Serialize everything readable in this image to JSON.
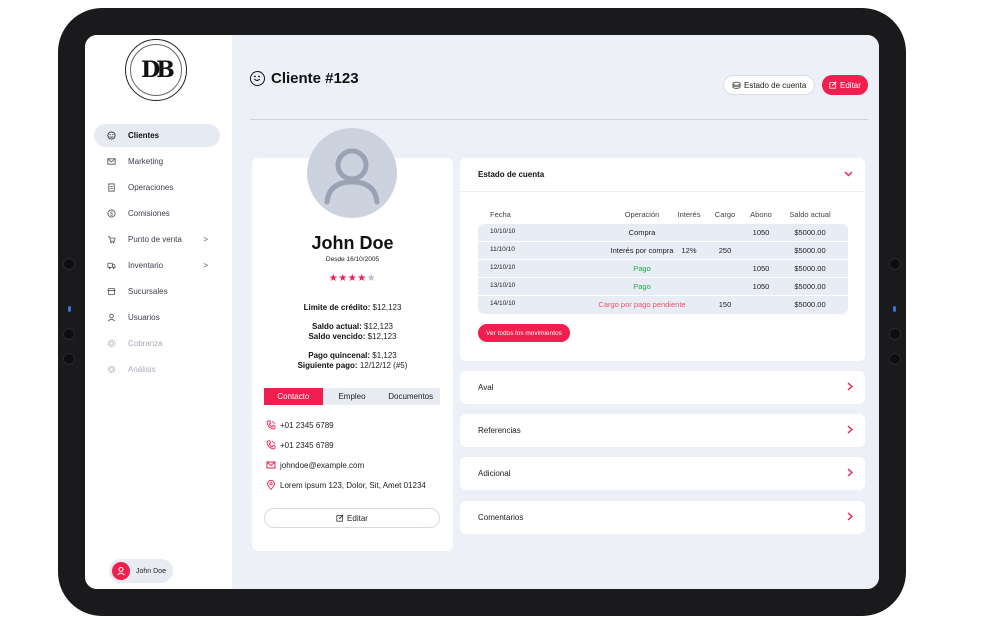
{
  "app": {
    "logo_text": "DB"
  },
  "sidebar": {
    "items": [
      {
        "label": "Clientes",
        "icon": "smile-icon"
      },
      {
        "label": "Marketing",
        "icon": "mail-icon"
      },
      {
        "label": "Operaciones",
        "icon": "document-icon"
      },
      {
        "label": "Comisiones",
        "icon": "coin-icon"
      },
      {
        "label": "Punto de venta",
        "icon": "cart-icon",
        "chevron": ">"
      },
      {
        "label": "Inventario",
        "icon": "truck-icon",
        "chevron": ">"
      },
      {
        "label": "Sucursales",
        "icon": "store-icon"
      },
      {
        "label": "Usuarios",
        "icon": "user-icon"
      },
      {
        "label": "Cobranza",
        "icon": "gear-icon"
      },
      {
        "label": "Análisis",
        "icon": "gear-icon"
      }
    ],
    "user_chip": {
      "name": "John Doe"
    }
  },
  "header": {
    "title": "Cliente #123",
    "account_button": "Estado de cuenta",
    "edit_button": "Editar"
  },
  "profile": {
    "name": "John Doe",
    "since": "Desde 16/10/2005",
    "rating": 4,
    "rating_max": 5,
    "credit_limit_label": "Limite de crédito:",
    "credit_limit_value": "$12,123",
    "saldo_actual_label": "Saldo actual:",
    "saldo_actual_value": "$12,123",
    "saldo_vencido_label": "Saldo vencido:",
    "saldo_vencido_value": "$12,123",
    "pago_label": "Pago quincenal:",
    "pago_value": "$1,123",
    "siguiente_label": "Siguiente pago:",
    "siguiente_value": "12/12/12 (#5)",
    "tabs": [
      "Contacto",
      "Empleo",
      "Documentos"
    ],
    "contacts": [
      {
        "icon": "phone-icon",
        "text": "+01 2345 6789"
      },
      {
        "icon": "phone-icon",
        "text": "+01 2345 6789"
      },
      {
        "icon": "mail-icon",
        "text": "johndoe@example.com"
      },
      {
        "icon": "location-icon",
        "text": "Lorem ipsum 123, Dolor, Sit, Amet 01234"
      }
    ],
    "edit_button": "Editar"
  },
  "account": {
    "title": "Estado de cuenta",
    "columns": [
      "Fecha",
      "Operación",
      "Interés",
      "Cargo",
      "Abono",
      "Saldo actual"
    ],
    "rows": [
      {
        "fecha": "10/10/10",
        "operacion": "Compra",
        "interes": "",
        "cargo": "",
        "abono": "1050",
        "saldo": "$5000.00",
        "type": "normal"
      },
      {
        "fecha": "11/10/10",
        "operacion": "Interés por compra",
        "interes": "12%",
        "cargo": "250",
        "abono": "",
        "saldo": "$5000.00",
        "type": "normal"
      },
      {
        "fecha": "12/10/10",
        "operacion": "Pago",
        "interes": "",
        "cargo": "",
        "abono": "1050",
        "saldo": "$5000.00",
        "type": "pago"
      },
      {
        "fecha": "13/10/10",
        "operacion": "Pago",
        "interes": "",
        "cargo": "",
        "abono": "1050",
        "saldo": "$5000.00",
        "type": "pago"
      },
      {
        "fecha": "14/10/10",
        "operacion": "Cargo por pago pendiente",
        "interes": "",
        "cargo": "150",
        "abono": "",
        "saldo": "$5000.00",
        "type": "cargo"
      }
    ],
    "view_all_button": "Ver todos los movimientos"
  },
  "sections": [
    "Aval",
    "Referencias",
    "Adicional",
    "Comentarios"
  ],
  "colors": {
    "accent": "#f21e4d",
    "pago": "#1fa84a",
    "cargo": "#f0506e"
  }
}
